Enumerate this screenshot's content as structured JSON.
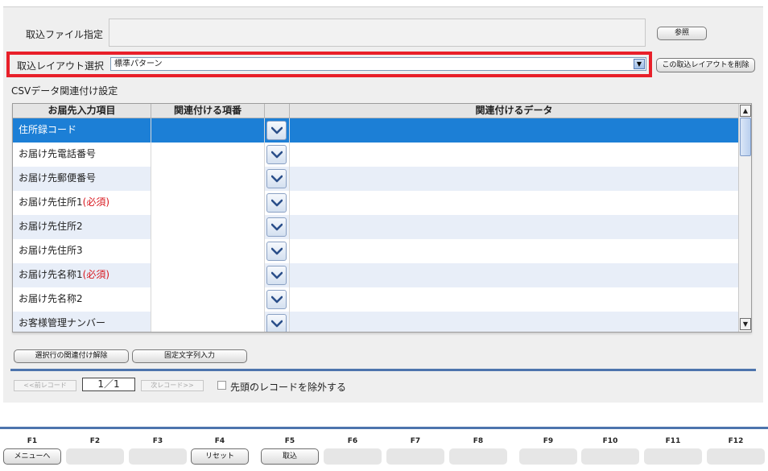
{
  "form": {
    "file_label": "取込ファイル指定",
    "browse_button": "参照",
    "layout_label": "取込レイアウト選択",
    "layout_selected": "標準パターン",
    "delete_layout_button": "この取込レイアウトを削除",
    "section_title": "CSVデータ関連付け設定"
  },
  "grid": {
    "headers": {
      "col1": "お届先入力項目",
      "col2": "関連付ける項番",
      "col4": "関連付けるデータ"
    },
    "rows": [
      {
        "label": "住所録コード",
        "required": ""
      },
      {
        "label": "お届け先電話番号",
        "required": ""
      },
      {
        "label": "お届け先郵便番号",
        "required": ""
      },
      {
        "label": "お届け先住所1",
        "required": "(必須)"
      },
      {
        "label": "お届け先住所2",
        "required": ""
      },
      {
        "label": "お届け先住所3",
        "required": ""
      },
      {
        "label": "お届け先名称1",
        "required": "(必須)"
      },
      {
        "label": "お届け先名称2",
        "required": ""
      },
      {
        "label": "お客様管理ナンバー",
        "required": ""
      }
    ],
    "selected_row": 0
  },
  "actions": {
    "unlink_button": "選択行の関連付け解除",
    "fixed_string_button": "固定文字列入力"
  },
  "records": {
    "prev_label": "<<前レコード",
    "counter": "1／1",
    "next_label": "次レコード>>",
    "exclude_first_label": "先頭のレコードを除外する"
  },
  "fkeys": [
    {
      "key": "F1",
      "label": "メニューへ"
    },
    {
      "key": "F2",
      "label": ""
    },
    {
      "key": "F3",
      "label": ""
    },
    {
      "key": "F4",
      "label": "リセット"
    },
    {
      "key": "F5",
      "label": "取込"
    },
    {
      "key": "F6",
      "label": ""
    },
    {
      "key": "F7",
      "label": ""
    },
    {
      "key": "F8",
      "label": ""
    },
    {
      "key": "F9",
      "label": ""
    },
    {
      "key": "F10",
      "label": ""
    },
    {
      "key": "F11",
      "label": ""
    },
    {
      "key": "F12",
      "label": ""
    }
  ],
  "colors": {
    "selected_row": "#1c7fd6",
    "highlight_frame": "#e8202a",
    "accent_bar": "#4d74ad",
    "required_text": "#d8181f"
  }
}
